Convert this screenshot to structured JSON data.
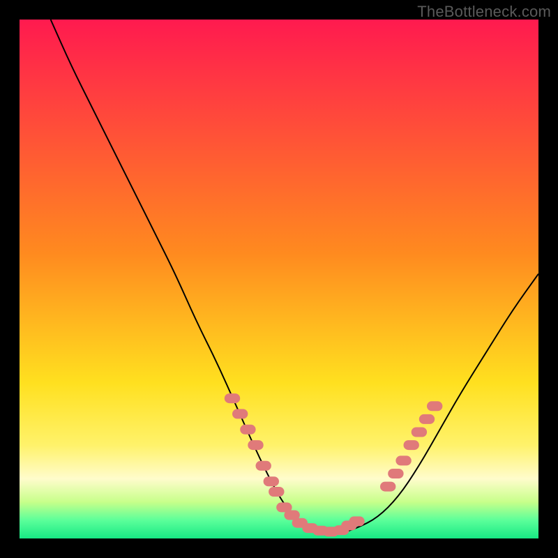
{
  "watermark": "TheBottleneck.com",
  "chart_data": {
    "type": "line",
    "title": "",
    "xlabel": "",
    "ylabel": "",
    "xlim": [
      0,
      100
    ],
    "ylim": [
      0,
      100
    ],
    "grid": false,
    "legend": false,
    "background": {
      "type": "vertical-gradient",
      "stops": [
        {
          "offset": 0.0,
          "color": "#ff1a4f"
        },
        {
          "offset": 0.45,
          "color": "#ff8a1f"
        },
        {
          "offset": 0.7,
          "color": "#ffe01f"
        },
        {
          "offset": 0.82,
          "color": "#fff26a"
        },
        {
          "offset": 0.885,
          "color": "#fffccc"
        },
        {
          "offset": 0.93,
          "color": "#c7ff8a"
        },
        {
          "offset": 0.965,
          "color": "#5bff9a"
        },
        {
          "offset": 1.0,
          "color": "#17e884"
        }
      ]
    },
    "series": [
      {
        "name": "bottleneck-curve",
        "color": "#000000",
        "width": 2,
        "x": [
          6,
          10,
          14,
          18,
          22,
          26,
          30,
          34,
          38,
          42,
          46,
          50,
          53,
          56,
          59,
          62,
          65,
          69,
          73,
          77,
          81,
          85,
          90,
          95,
          100
        ],
        "y": [
          100,
          91,
          83,
          75,
          67,
          59,
          51,
          42,
          34,
          25,
          16,
          8,
          4,
          2,
          1,
          1,
          2,
          4,
          8,
          14,
          21,
          28,
          36,
          44,
          51
        ]
      }
    ],
    "marker_groups": [
      {
        "name": "left-cluster",
        "color": "#e07a7a",
        "shape": "round",
        "size": 14,
        "points": [
          {
            "x": 41,
            "y": 27
          },
          {
            "x": 42.5,
            "y": 24
          },
          {
            "x": 44,
            "y": 21
          },
          {
            "x": 45.5,
            "y": 18
          },
          {
            "x": 47,
            "y": 14
          },
          {
            "x": 48.5,
            "y": 11
          }
        ]
      },
      {
        "name": "valley-cluster",
        "color": "#e07a7a",
        "shape": "round",
        "size": 14,
        "points": [
          {
            "x": 49.5,
            "y": 9
          },
          {
            "x": 51,
            "y": 6
          },
          {
            "x": 52.5,
            "y": 4.5
          },
          {
            "x": 54,
            "y": 3
          },
          {
            "x": 56,
            "y": 2
          },
          {
            "x": 58,
            "y": 1.5
          },
          {
            "x": 60,
            "y": 1.3
          },
          {
            "x": 62,
            "y": 1.6
          },
          {
            "x": 63.5,
            "y": 2.5
          },
          {
            "x": 65,
            "y": 3.3
          }
        ]
      },
      {
        "name": "right-cluster",
        "color": "#e07a7a",
        "shape": "round",
        "size": 14,
        "points": [
          {
            "x": 71,
            "y": 10
          },
          {
            "x": 72.5,
            "y": 12.5
          },
          {
            "x": 74,
            "y": 15
          },
          {
            "x": 75.5,
            "y": 18
          },
          {
            "x": 77,
            "y": 20.5
          },
          {
            "x": 78.5,
            "y": 23
          },
          {
            "x": 80,
            "y": 25.5
          }
        ]
      }
    ]
  }
}
